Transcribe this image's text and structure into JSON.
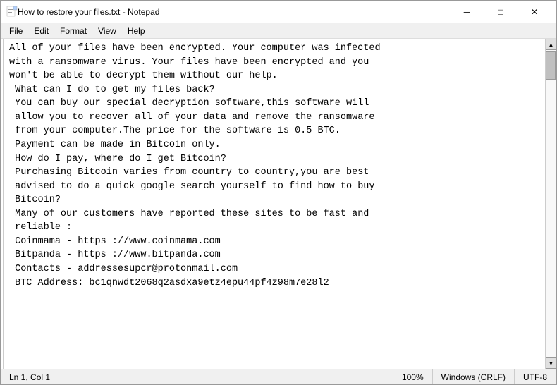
{
  "window": {
    "title": "How to restore your files.txt - Notepad",
    "icon": "notepad-icon"
  },
  "titlebar": {
    "minimize_label": "─",
    "maximize_label": "□",
    "close_label": "✕"
  },
  "menu": {
    "items": [
      {
        "label": "File",
        "id": "file"
      },
      {
        "label": "Edit",
        "id": "edit"
      },
      {
        "label": "Format",
        "id": "format"
      },
      {
        "label": "View",
        "id": "view"
      },
      {
        "label": "Help",
        "id": "help"
      }
    ]
  },
  "editor": {
    "content": "All of your files have been encrypted. Your computer was infected\nwith a ransomware virus. Your files have been encrypted and you\nwon't be able to decrypt them without our help.\n What can I do to get my files back?\n You can buy our special decryption software,this software will\n allow you to recover all of your data and remove the ransomware\n from your computer.The price for the software is 0.5 BTC.\n Payment can be made in Bitcoin only.\n How do I pay, where do I get Bitcoin?\n Purchasing Bitcoin varies from country to country,you are best\n advised to do a quick google search yourself to find how to buy\n Bitcoin?\n Many of our customers have reported these sites to be fast and\n reliable :\n Coinmama - https ://www.coinmama.com\n Bitpanda - https ://www.bitpanda.com\n Contacts - addressesupcr@protonmail.com\n BTC Address: bc1qnwdt2068q2asdxa9etz4epu44pf4z98m7e28l2"
  },
  "statusbar": {
    "position": "Ln 1, Col 1",
    "zoom": "100%",
    "line_ending": "Windows (CRLF)",
    "encoding": "UTF-8"
  }
}
